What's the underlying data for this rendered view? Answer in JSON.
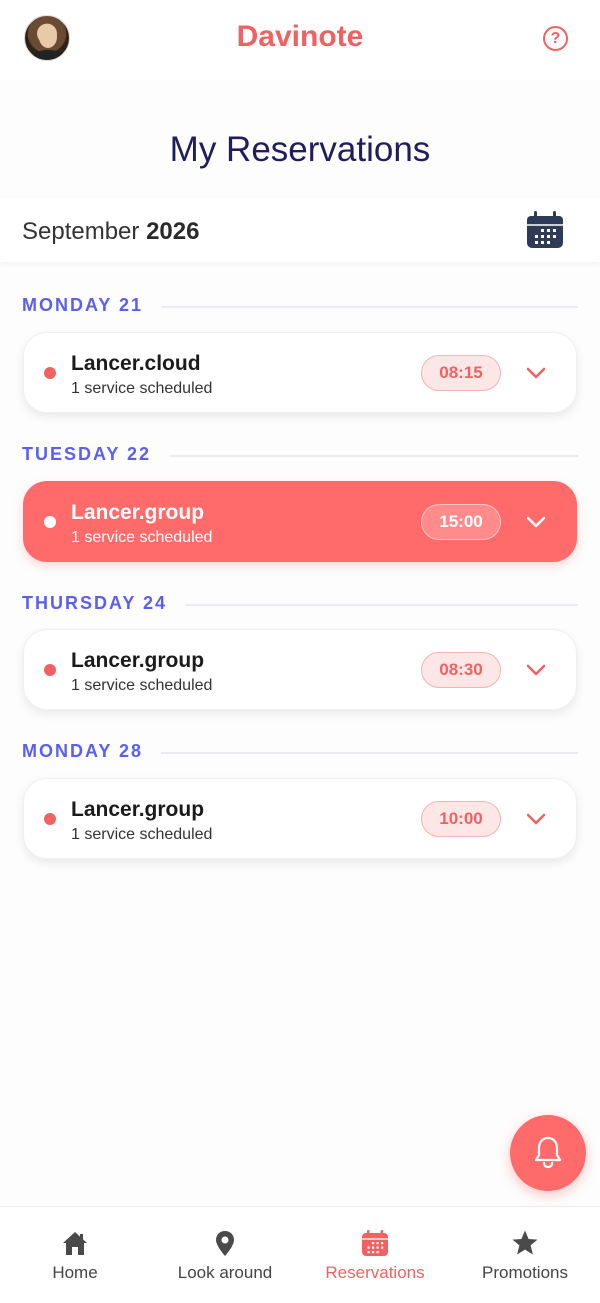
{
  "header": {
    "brand": "Davinote",
    "help_icon": "question-circle-icon",
    "avatar": "user-avatar"
  },
  "page": {
    "title": "My Reservations"
  },
  "month_bar": {
    "month": "September",
    "year": "2026",
    "calendar_icon": "calendar-icon"
  },
  "days": [
    {
      "label": "MONDAY 21",
      "reservation": {
        "name": "Lancer.cloud",
        "subtitle": "1 service scheduled",
        "time": "08:15",
        "active": false
      }
    },
    {
      "label": "TUESDAY 22",
      "reservation": {
        "name": "Lancer.group",
        "subtitle": "1 service scheduled",
        "time": "15:00",
        "active": true
      }
    },
    {
      "label": "THURSDAY 24",
      "reservation": {
        "name": "Lancer.group",
        "subtitle": "1 service scheduled",
        "time": "08:30",
        "active": false
      }
    },
    {
      "label": "MONDAY 28",
      "reservation": {
        "name": "Lancer.group",
        "subtitle": "1 service scheduled",
        "time": "10:00",
        "active": false
      }
    }
  ],
  "fab": {
    "icon": "bell-icon"
  },
  "bottom_nav": [
    {
      "label": "Home",
      "icon": "home-icon",
      "active": false
    },
    {
      "label": "Look around",
      "icon": "map-pin-icon",
      "active": false
    },
    {
      "label": "Reservations",
      "icon": "calendar-icon",
      "active": true
    },
    {
      "label": "Promotions",
      "icon": "star-icon",
      "active": false
    }
  ],
  "colors": {
    "accent": "#f06262",
    "accent_active": "#ff6b6b",
    "day_label": "#5a5ff2",
    "title": "#1f1d5c"
  }
}
